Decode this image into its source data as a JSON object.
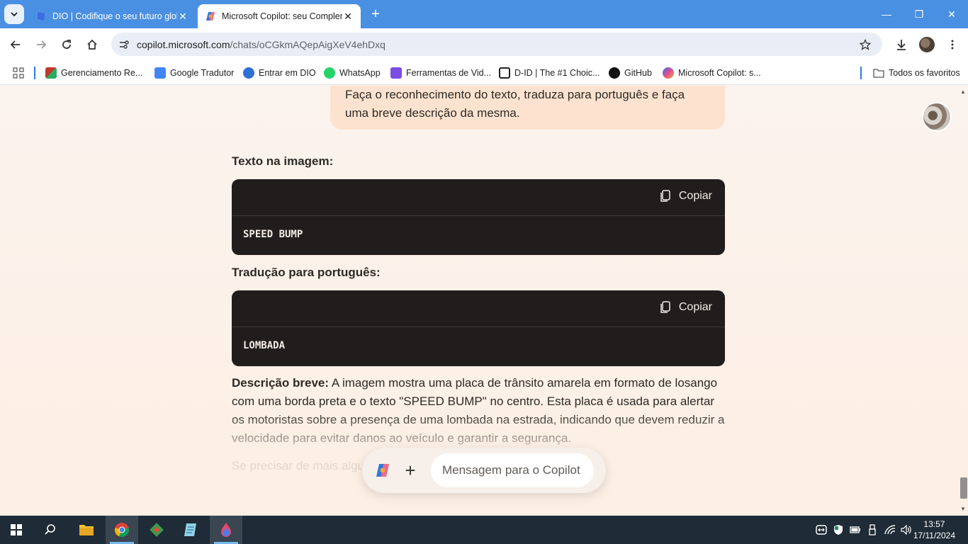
{
  "browser": {
    "tabs": [
      {
        "title": "DIO | Codifique o seu futuro global",
        "close": "✕",
        "active": false
      },
      {
        "title": "Microsoft Copilot: seu Complemento de IA",
        "close": "✕",
        "active": true
      }
    ],
    "new_tab": "+",
    "window_controls": {
      "minimize": "—",
      "maximize": "❐",
      "close": "✕"
    },
    "url_host": "copilot.microsoft.com",
    "url_path": "/chats/oCGkmAQepAigXeV4ehDxq",
    "bookmarks": [
      {
        "label": "Gerenciamento Re...",
        "icon": "gerenciamento-icon",
        "color": "#c0392b"
      },
      {
        "label": "Google Tradutor",
        "icon": "google-translate-icon",
        "color": "#4285f4"
      },
      {
        "label": "Entrar em DIO",
        "icon": "dio-icon",
        "color": "#2f6fd6"
      },
      {
        "label": "WhatsApp",
        "icon": "whatsapp-icon",
        "color": "#25d366"
      },
      {
        "label": "Ferramentas de Vid...",
        "icon": "video-tools-icon",
        "color": "#7b4de0"
      },
      {
        "label": "D-ID | The #1 Choic...",
        "icon": "d-id-icon",
        "color": "#222222"
      },
      {
        "label": "GitHub",
        "icon": "github-icon",
        "color": "#111111"
      },
      {
        "label": "Microsoft Copilot: s...",
        "icon": "copilot-icon",
        "color": "#e14c8d"
      }
    ],
    "all_bookmarks": "Todos os favoritos"
  },
  "chat": {
    "user_message": "Faça o reconhecimento do texto, traduza para português e faça uma breve descrição da mesma.",
    "section1_heading": "Texto na imagem:",
    "code1": {
      "copy_label": "Copiar",
      "text": "SPEED BUMP"
    },
    "section2_heading": "Tradução para português:",
    "code2": {
      "copy_label": "Copiar",
      "text": "LOMBADA"
    },
    "description_label": "Descrição breve:",
    "description_text": "A imagem mostra uma placa de trânsito amarela em formato de losango com uma borda preta e o texto \"SPEED BUMP\" no centro. Esta placa é usada para alertar os motoristas sobre a presença de uma lombada na estrada, indicando que devem reduzir a velocidade para evitar danos ao veículo e garantir a segurança.",
    "trailing_text": "Se precisar de mais algu",
    "composer_placeholder": "Mensagem para o Copilot",
    "composer_plus": "+"
  },
  "taskbar": {
    "apps": [
      "start-icon",
      "search-icon",
      "file-explorer-icon",
      "chrome-icon",
      "git-icon",
      "notepad-icon",
      "paint-icon"
    ],
    "time": "13:57",
    "date": "17/11/2024"
  },
  "colors": {
    "tabstrip": "#4a90e2",
    "user_bubble": "#fde3cf",
    "code_block": "#211d1c",
    "page_bg": "#fcefe4",
    "taskbar": "#1f2b36"
  }
}
